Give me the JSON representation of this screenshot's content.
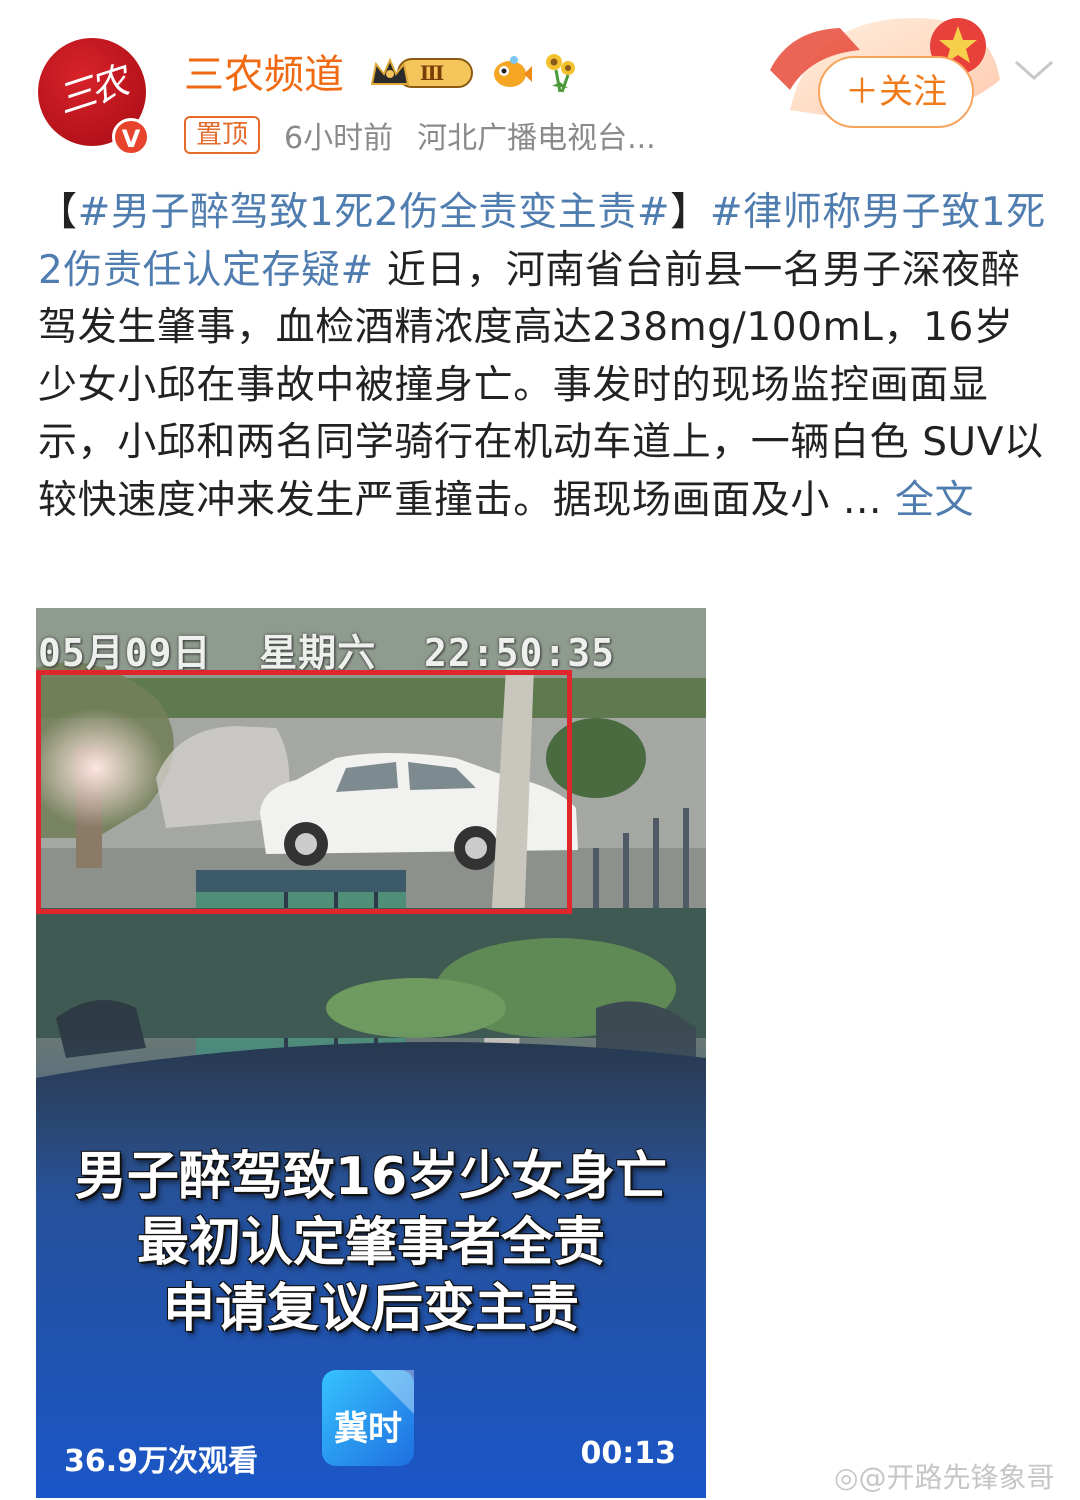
{
  "header": {
    "avatar_text": "三农",
    "verified_mark": "V",
    "username": "三农频道",
    "vip_level": "Ⅲ",
    "pinned_label": "置顶",
    "time": "6小时前",
    "source": "河北广播电视台...",
    "follow_label": "＋关注",
    "colors": {
      "username": "#f06a14",
      "link": "#507daf",
      "follow": "#f07b1a"
    }
  },
  "post": {
    "text_open": "【",
    "topic1": "#男子醉驾致1死2伤全责变主责#",
    "text_mid": "】",
    "topic2": "#律师称男子致1死2伤责任认定存疑#",
    "body": " 近日，河南省台前县一名男子深夜醉驾发生肇事，血检酒精浓度高达238mg/100mL，16岁少女小邱在事故中被撞身亡。事发时的现场监控画面显示，小邱和两名同学骑行在机动车道上，一辆白色 SUV以较快速度冲来发生严重撞击。据现场画面及小 ... ",
    "full_text_label": "全文"
  },
  "video": {
    "timestamp": "05月09日  星期六  22:50:35",
    "caption_lines": [
      "男子醉驾致16岁少女身亡",
      "最初认定肇事者全责",
      "申请复议后变主责"
    ],
    "logo_text": "冀时",
    "view_count": "36.9万次观看",
    "duration": "00:13"
  },
  "watermark": "@开路先锋象哥"
}
